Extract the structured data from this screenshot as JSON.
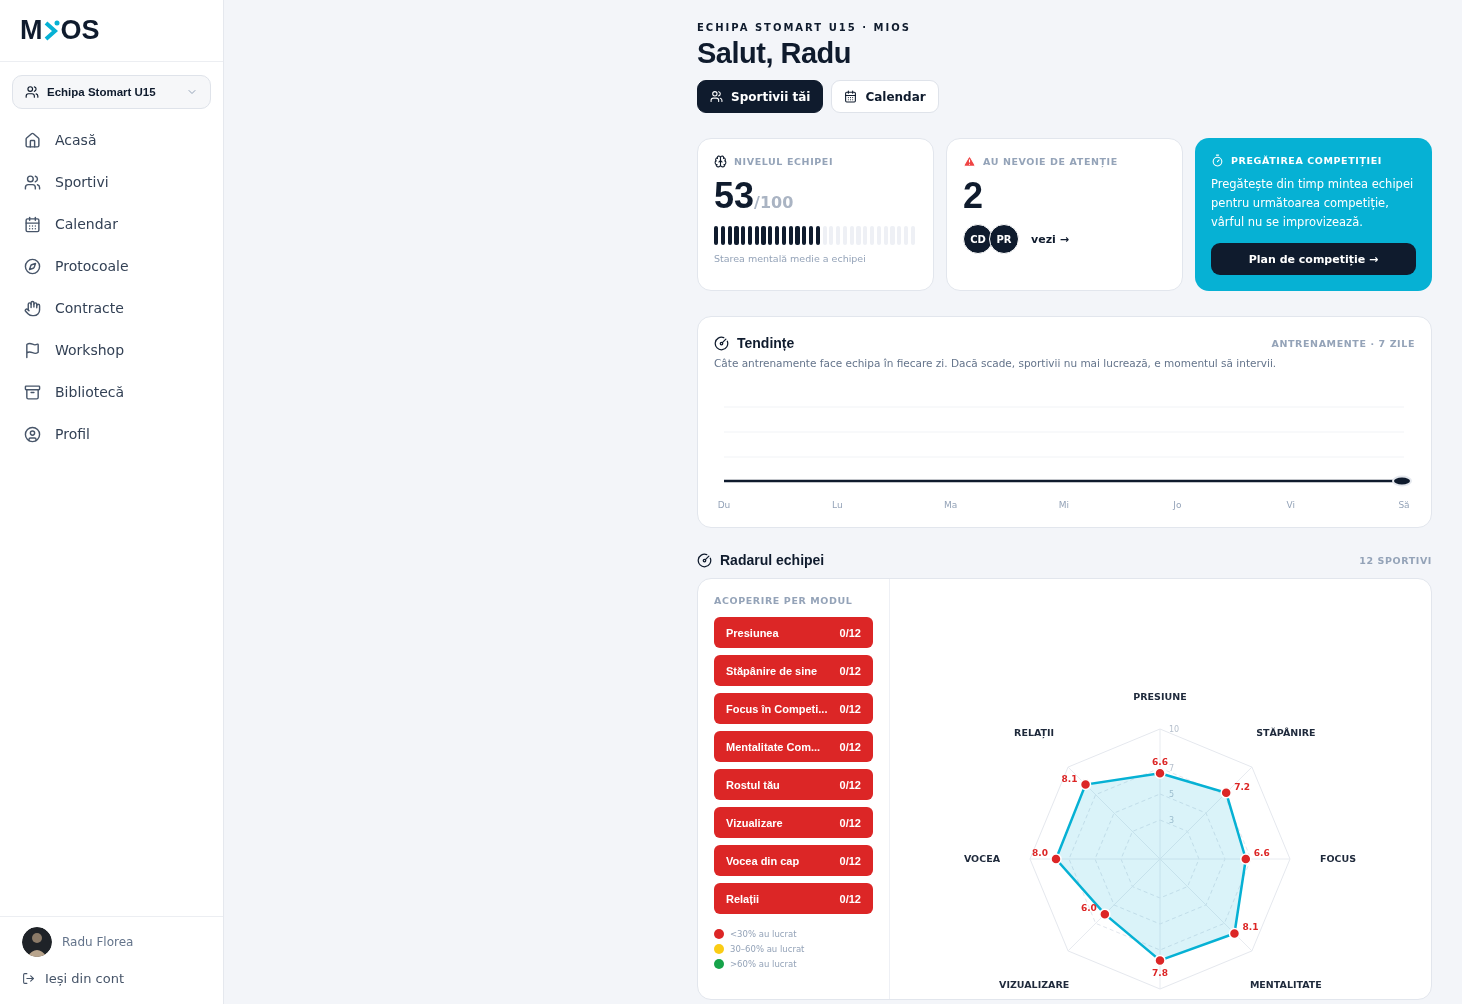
{
  "sidebar": {
    "logo": {
      "left": "M",
      "right": "OS"
    },
    "team_select": {
      "label": "Echipa Stomart U15"
    },
    "items": [
      {
        "label": "Acasă"
      },
      {
        "label": "Sportivi"
      },
      {
        "label": "Calendar"
      },
      {
        "label": "Protocoale"
      },
      {
        "label": "Contracte"
      },
      {
        "label": "Workshop"
      },
      {
        "label": "Bibliotecă"
      },
      {
        "label": "Profil"
      }
    ],
    "user": {
      "name": "Radu Florea"
    },
    "logout": "Ieși din cont"
  },
  "header": {
    "eyebrow": "ECHIPA STOMART U15 · MIOS",
    "title": "Salut, Radu",
    "tabs": [
      {
        "label": "Sportivii tăi",
        "selected": true
      },
      {
        "label": "Calendar",
        "selected": false
      }
    ]
  },
  "cards": {
    "level": {
      "title": "NIVELUL ECHIPEI",
      "value": "53",
      "max": "/100",
      "level": 0.53,
      "caption": "Starea mentală medie a echipei"
    },
    "attention": {
      "title": "AU NEVOIE DE ATENȚIE",
      "value": "2",
      "initials": [
        "CD",
        "PR"
      ],
      "link": "vezi →"
    },
    "competition": {
      "title": "PREGĂTIREA COMPETIȚIEI",
      "text": "Pregătește din timp mintea echipei pentru următoarea competiție, vârful nu se improvizează.",
      "button": "Plan de competiție →"
    }
  },
  "trends": {
    "title": "Tendințe",
    "meta": "ANTRENAMENTE · 7 ZILE",
    "description": "Câte antrenamente face echipa în fiecare zi. Dacă scade, sportivii nu mai lucrează, e momentul să intervii.",
    "day_labels": [
      "Du",
      "Lu",
      "Ma",
      "Mi",
      "Jo",
      "Vi",
      "Să"
    ]
  },
  "radar": {
    "title": "Radarul echipei",
    "meta": "12 SPORTIVI",
    "coverage_title": "ACOPERIRE PER MODUL",
    "modules": [
      {
        "name": "Presiunea",
        "count": "0/12",
        "color": "#dc2626"
      },
      {
        "name": "Stăpânire de sine",
        "count": "0/12",
        "color": "#dc2626"
      },
      {
        "name": "Focus în Competi...",
        "count": "0/12",
        "color": "#dc2626"
      },
      {
        "name": "Mentalitate Com...",
        "count": "0/12",
        "color": "#dc2626"
      },
      {
        "name": "Rostul tău",
        "count": "0/12",
        "color": "#dc2626"
      },
      {
        "name": "Vizualizare",
        "count": "0/12",
        "color": "#dc2626"
      },
      {
        "name": "Vocea din cap",
        "count": "0/12",
        "color": "#dc2626"
      },
      {
        "name": "Relații",
        "count": "0/12",
        "color": "#dc2626"
      }
    ],
    "legend": [
      {
        "label": "<30% au lucrat",
        "color": "#dc2626"
      },
      {
        "label": "30–60% au lucrat",
        "color": "#facc15"
      },
      {
        "label": ">60% au lucrat",
        "color": "#16a34a"
      }
    ],
    "radar_axes": [
      {
        "label": "PRESIUNE",
        "value": "6.6"
      },
      {
        "label": "STĂPÂNIRE",
        "value": "7.2"
      },
      {
        "label": "FOCUS",
        "value": "6.6"
      },
      {
        "label": "MENTALITATE",
        "value": "8.1"
      },
      {
        "value": "7.8"
      },
      {
        "label": "VIZUALIZARE",
        "value": "6.0"
      },
      {
        "label": "VOCEA",
        "value": "8.0"
      },
      {
        "label": "RELAȚII",
        "value": "8.1"
      }
    ],
    "ring_labels": [
      "10",
      "7",
      "5",
      "3"
    ]
  }
}
